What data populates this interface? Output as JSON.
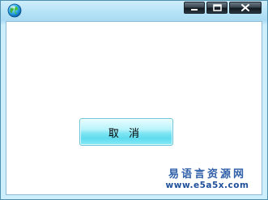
{
  "window": {
    "controls": {
      "minimize_icon": "minimize-icon",
      "maximize_icon": "maximize-icon",
      "close_icon": "close-icon"
    }
  },
  "dialog": {
    "cancel_label": "取 消"
  },
  "watermark": {
    "brand": "易语言资源网",
    "url": "www.e5a5x.com"
  },
  "colors": {
    "frame": "#cdeefd",
    "button_top": "#e9fdff",
    "button_bottom": "#5fdcef",
    "watermark_text": "#2f5fa8"
  }
}
